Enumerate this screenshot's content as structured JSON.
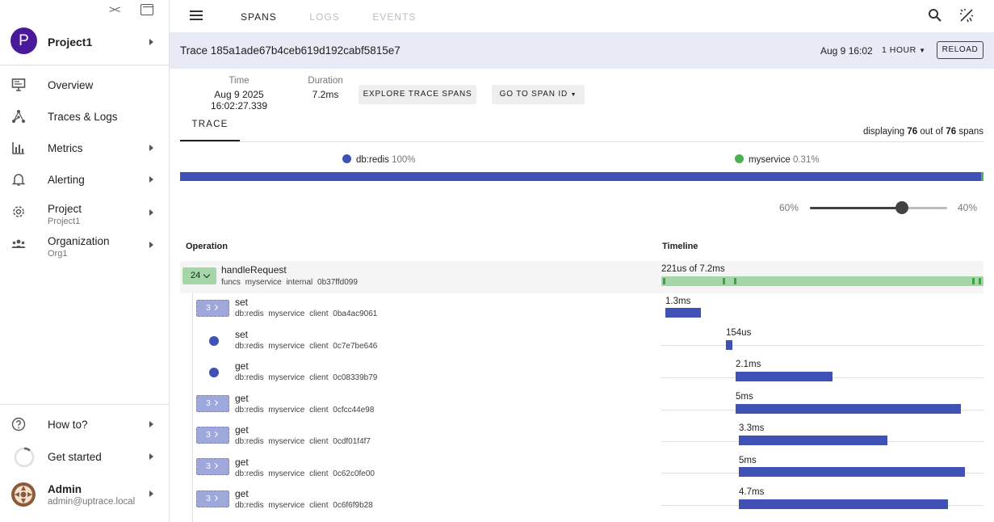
{
  "sidebar": {
    "project": {
      "avatar_letter": "P",
      "name": "Project1"
    },
    "nav": [
      {
        "label": "Overview",
        "icon": "monitor-icon"
      },
      {
        "label": "Traces & Logs",
        "icon": "graph-nodes-icon"
      },
      {
        "label": "Metrics",
        "icon": "bar-chart-icon"
      },
      {
        "label": "Alerting",
        "icon": "bell-icon"
      },
      {
        "label": "Project",
        "sub": "Project1",
        "icon": "gear-icon"
      },
      {
        "label": "Organization",
        "sub": "Org1",
        "icon": "group-icon"
      }
    ],
    "footer": {
      "howto": "How to?",
      "get_started": "Get started",
      "user_name": "Admin",
      "user_email": "admin@uptrace.local"
    }
  },
  "topbar": {
    "tabs": [
      "SPANS",
      "LOGS",
      "EVENTS"
    ],
    "active_tab": "SPANS"
  },
  "trace": {
    "title": "Trace 185a1ade67b4ceb619d192cabf5815e7",
    "date": "Aug 9 16:02",
    "period": "1 HOUR",
    "reload": "RELOAD",
    "time_label": "Time",
    "time_value": "Aug 9 2025 16:02:27.339",
    "duration_label": "Duration",
    "duration_value": "7.2ms",
    "explore_btn": "EXPLORE TRACE SPANS",
    "goto_btn": "GO TO SPAN ID",
    "tab": "TRACE",
    "displaying_prefix": "displaying",
    "displaying_count": "76",
    "displaying_mid": "out of",
    "displaying_total": "76",
    "displaying_suffix": "spans"
  },
  "legend": [
    {
      "name": "db:redis",
      "pct": "100%",
      "color": "#3f51b5"
    },
    {
      "name": "myservice",
      "pct": "0.31%",
      "color": "#4caf50"
    }
  ],
  "slider": {
    "left": "60%",
    "right": "40%",
    "value": 0.67
  },
  "table": {
    "col_operation": "Operation",
    "col_timeline": "Timeline",
    "root": {
      "count": "24",
      "name": "handleRequest",
      "attrs": "funcs myservice internal 0b37ffd099",
      "timeline": "221us of 7.2ms"
    },
    "rows": [
      {
        "badge": "3",
        "name": "set",
        "attrs": "db:redis myservice client 0ba4ac9061",
        "duration": "1.3ms"
      },
      {
        "badge": "",
        "name": "set",
        "attrs": "db:redis myservice client 0c7e7be646",
        "duration": "154us"
      },
      {
        "badge": "",
        "name": "get",
        "attrs": "db:redis myservice client 0c08339b79",
        "duration": "2.1ms"
      },
      {
        "badge": "3",
        "name": "get",
        "attrs": "db:redis myservice client 0cfcc44e98",
        "duration": "5ms"
      },
      {
        "badge": "3",
        "name": "get",
        "attrs": "db:redis myservice client 0cdf01f4f7",
        "duration": "3.3ms"
      },
      {
        "badge": "3",
        "name": "get",
        "attrs": "db:redis myservice client 0c62c0fe00",
        "duration": "5ms"
      },
      {
        "badge": "3",
        "name": "get",
        "attrs": "db:redis myservice client 0c6f6f9b28",
        "duration": "4.7ms"
      }
    ]
  }
}
